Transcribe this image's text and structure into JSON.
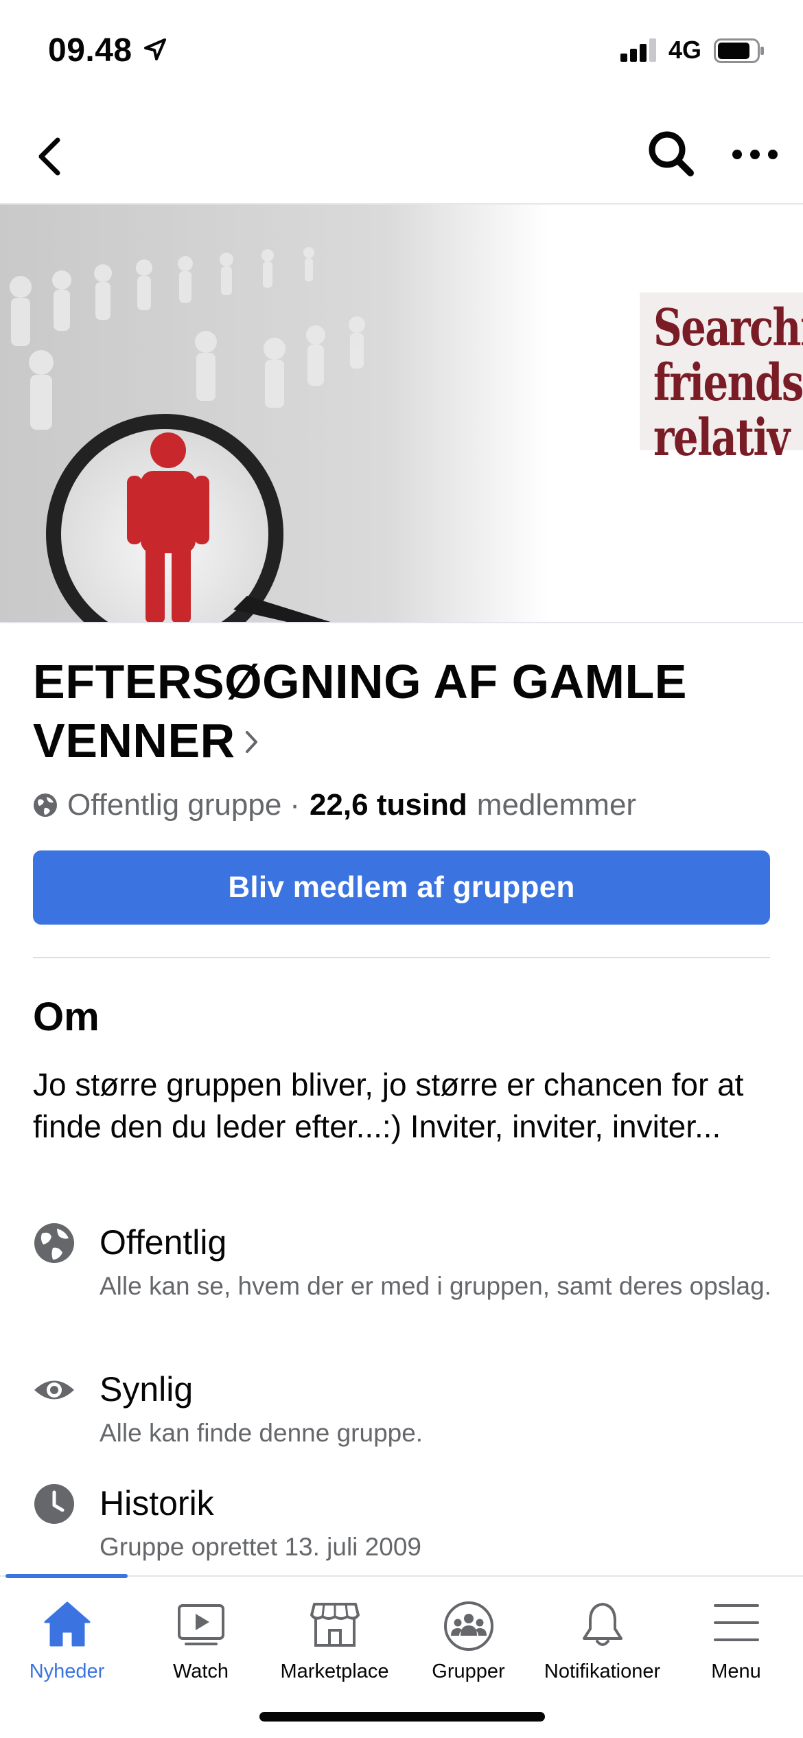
{
  "status_bar": {
    "time": "09.48",
    "network": "4G"
  },
  "cover": {
    "text_lines": [
      "Searchi",
      "friends",
      "relativ"
    ]
  },
  "group": {
    "title": "EFTERSØGNING AF GAMLE VENNER",
    "privacy": "Offentlig gruppe",
    "separator": "·",
    "member_count": "22,6 tusind",
    "members_label": "medlemmer",
    "join_button": "Bliv medlem af gruppen"
  },
  "about": {
    "heading": "Om",
    "description": "Jo større gruppen bliver, jo større er chancen for at finde den du leder efter...:) Inviter, inviter, inviter...",
    "items": [
      {
        "title": "Offentlig",
        "subtitle": "Alle kan se, hvem der er med i gruppen, samt deres opslag.",
        "icon": "globe-icon"
      },
      {
        "title": "Synlig",
        "subtitle": "Alle kan finde denne gruppe.",
        "icon": "eye-icon"
      },
      {
        "title": "Historik",
        "subtitle": "Gruppe oprettet 13. juli 2009",
        "icon": "clock-icon"
      }
    ]
  },
  "tab_bar": {
    "active": "Nyheder",
    "accent_color": "#3b74e0",
    "tabs": [
      {
        "label": "Nyheder",
        "icon": "home-icon"
      },
      {
        "label": "Watch",
        "icon": "watch-icon"
      },
      {
        "label": "Marketplace",
        "icon": "marketplace-icon"
      },
      {
        "label": "Grupper",
        "icon": "groups-icon"
      },
      {
        "label": "Notifikationer",
        "icon": "bell-icon"
      },
      {
        "label": "Menu",
        "icon": "menu-icon"
      }
    ]
  }
}
